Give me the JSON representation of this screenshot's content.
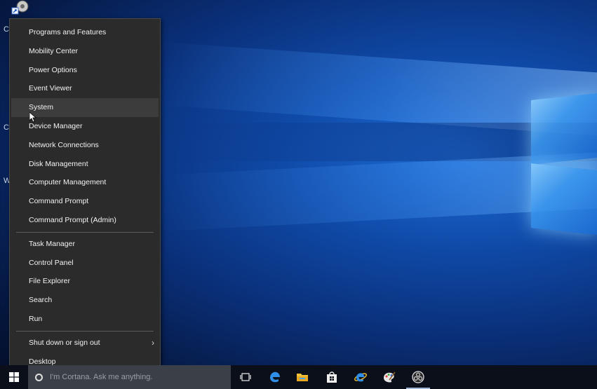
{
  "menu": {
    "group1": [
      {
        "label": "Programs and Features"
      },
      {
        "label": "Mobility Center"
      },
      {
        "label": "Power Options"
      },
      {
        "label": "Event Viewer"
      },
      {
        "label": "System"
      },
      {
        "label": "Device Manager"
      },
      {
        "label": "Network Connections"
      },
      {
        "label": "Disk Management"
      },
      {
        "label": "Computer Management"
      },
      {
        "label": "Command Prompt"
      },
      {
        "label": "Command Prompt (Admin)"
      }
    ],
    "group2": [
      {
        "label": "Task Manager"
      },
      {
        "label": "Control Panel"
      },
      {
        "label": "File Explorer"
      },
      {
        "label": "Search"
      },
      {
        "label": "Run"
      }
    ],
    "group3": [
      {
        "label": "Shut down or sign out"
      },
      {
        "label": "Desktop"
      }
    ]
  },
  "taskbar": {
    "cortana_placeholder": "I'm Cortana. Ask me anything."
  },
  "desktop": {
    "side_letters": [
      "C",
      "C",
      "W"
    ]
  },
  "colors": {
    "menu_bg": "#2b2b2b",
    "menu_hover": "#3c3c3c",
    "taskbar_bg": "#0b0f1a",
    "cortana_bg": "#3b3f47"
  }
}
